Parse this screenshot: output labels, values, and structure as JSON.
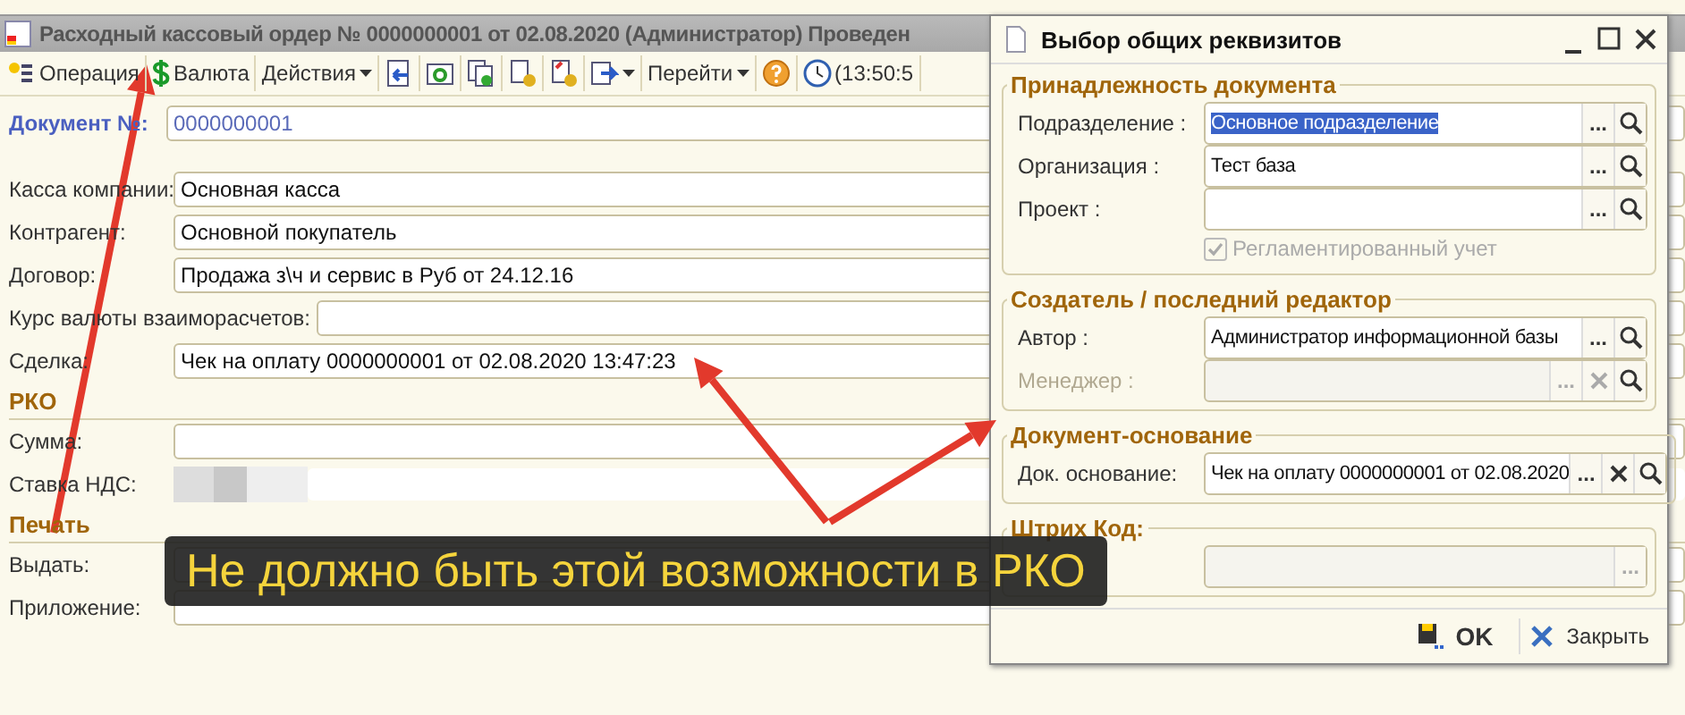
{
  "window": {
    "title": "Расходный кассовый ордер № 0000000001 от 02.08.2020 (Администратор) Проведен"
  },
  "toolbar": [
    {
      "kind": "labeled",
      "label": "Операция"
    },
    {
      "kind": "labeled",
      "label": "Валюта"
    },
    {
      "kind": "menu",
      "label": "Действия"
    },
    {
      "kind": "icon"
    },
    {
      "kind": "icon"
    },
    {
      "kind": "icon"
    },
    {
      "kind": "icon"
    },
    {
      "kind": "icon"
    },
    {
      "kind": "iconmenu"
    },
    {
      "kind": "menu",
      "label": "Перейти"
    },
    {
      "kind": "icon"
    },
    {
      "kind": "labeled",
      "label": "(13:50:5"
    }
  ],
  "document_number": {
    "label": "Документ №:",
    "value": "0000000001"
  },
  "form": [
    {
      "kind": "field",
      "label": "Касса компании:",
      "value": "Основная касса"
    },
    {
      "kind": "field",
      "label": "Контрагент:",
      "value": "Основной покупатель"
    },
    {
      "kind": "field",
      "label": "Договор:",
      "value": "Продажа з\\ч и сервис в Руб от 24.12.16"
    },
    {
      "kind": "widefield",
      "label": "Курс валюты взаиморасчетов:"
    },
    {
      "kind": "field",
      "label": "Сделка:",
      "value": "Чек на оплату 0000000001 от 02.08.2020 13:47:23"
    },
    {
      "kind": "section",
      "label": "РКО"
    },
    {
      "kind": "field",
      "label": "Сумма:"
    },
    {
      "kind": "blurred",
      "label": "Ставка НДС:"
    },
    {
      "kind": "section",
      "label": "Печать"
    },
    {
      "kind": "field",
      "label": "Выдать:"
    },
    {
      "kind": "field",
      "label": "Приложение:"
    }
  ],
  "dialog": {
    "title": "Выбор общих реквизитов",
    "groups": [
      {
        "title": "Принадлежность документа",
        "fields": [
          {
            "label": "Подразделение :",
            "value": "Основное подразделение",
            "selected": true,
            "disabled": false,
            "clear": false,
            "more": "..."
          },
          {
            "label": "Организация :",
            "value": "Тест база",
            "selected": false,
            "disabled": false,
            "clear": false,
            "more": "..."
          },
          {
            "label": "Проект :",
            "disabled": false,
            "clear": false,
            "more": "..."
          }
        ],
        "checkbox": {
          "label": "Регламентированный учет",
          "checked": true,
          "disabled": true
        }
      },
      {
        "title": "Создатель / последний редактор",
        "fields": [
          {
            "label": "Автор :",
            "value": "Администратор информационной базы",
            "selected": false,
            "disabled": false,
            "clear": false,
            "more": "..."
          },
          {
            "label": "Менеджер :",
            "disabled": true,
            "clear": true,
            "more": "..."
          }
        ]
      },
      {
        "title": "Документ-основание",
        "fields": [
          {
            "label": "Док. основание:",
            "value": "Чек на оплату 0000000001 от 02.08.2020",
            "selected": false,
            "disabled": false,
            "clear": true,
            "more": "..."
          }
        ]
      },
      {
        "title": "Штрих Код:",
        "fields": [
          {
            "disabled": true,
            "clear": false,
            "more": "...",
            "search": false
          }
        ]
      }
    ],
    "buttons": [
      {
        "kind": "ok",
        "label": "OK"
      },
      {
        "kind": "close",
        "label": "Закрыть"
      }
    ]
  },
  "banner": {
    "text": "Не должно быть этой возможности в РКО"
  }
}
